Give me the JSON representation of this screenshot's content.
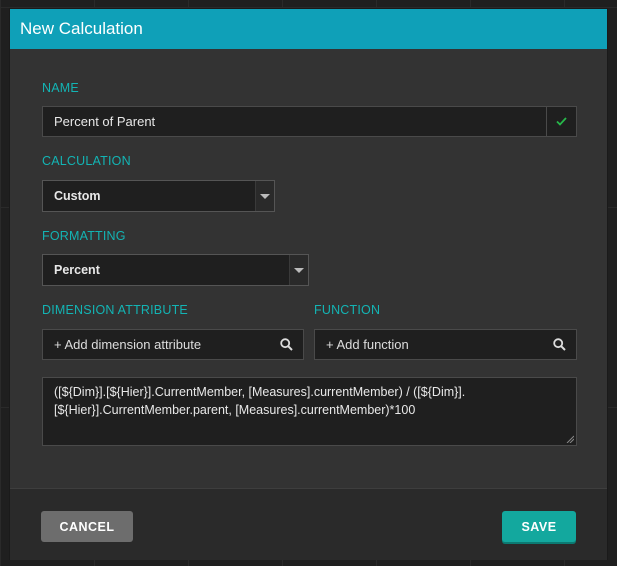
{
  "dialog": {
    "title": "New Calculation"
  },
  "name": {
    "label": "NAME",
    "value": "Percent of Parent"
  },
  "calculation": {
    "label": "CALCULATION",
    "selected": "Custom"
  },
  "formatting": {
    "label": "FORMATTING",
    "selected": "Percent"
  },
  "dimension_attribute": {
    "label": "DIMENSION ATTRIBUTE",
    "placeholder": "+ Add dimension attribute"
  },
  "function": {
    "label": "FUNCTION",
    "placeholder": "+ Add function"
  },
  "formula": {
    "line1": "([${Dim}].[${Hier}].CurrentMember, [Measures].currentMember) / ([${Dim}].",
    "line2": "[${Hier}].CurrentMember.parent, [Measures].currentMember)*100"
  },
  "footer": {
    "cancel_label": "CANCEL",
    "save_label": "SAVE"
  },
  "colors": {
    "header": "#0fa0b8",
    "label": "#13b4b4",
    "save": "#13a89e",
    "cancel": "#6d6d6d",
    "check": "#27b84a"
  },
  "icons": {
    "valid": "check-icon",
    "search": "search-icon",
    "dropdown": "caret-down-icon"
  }
}
